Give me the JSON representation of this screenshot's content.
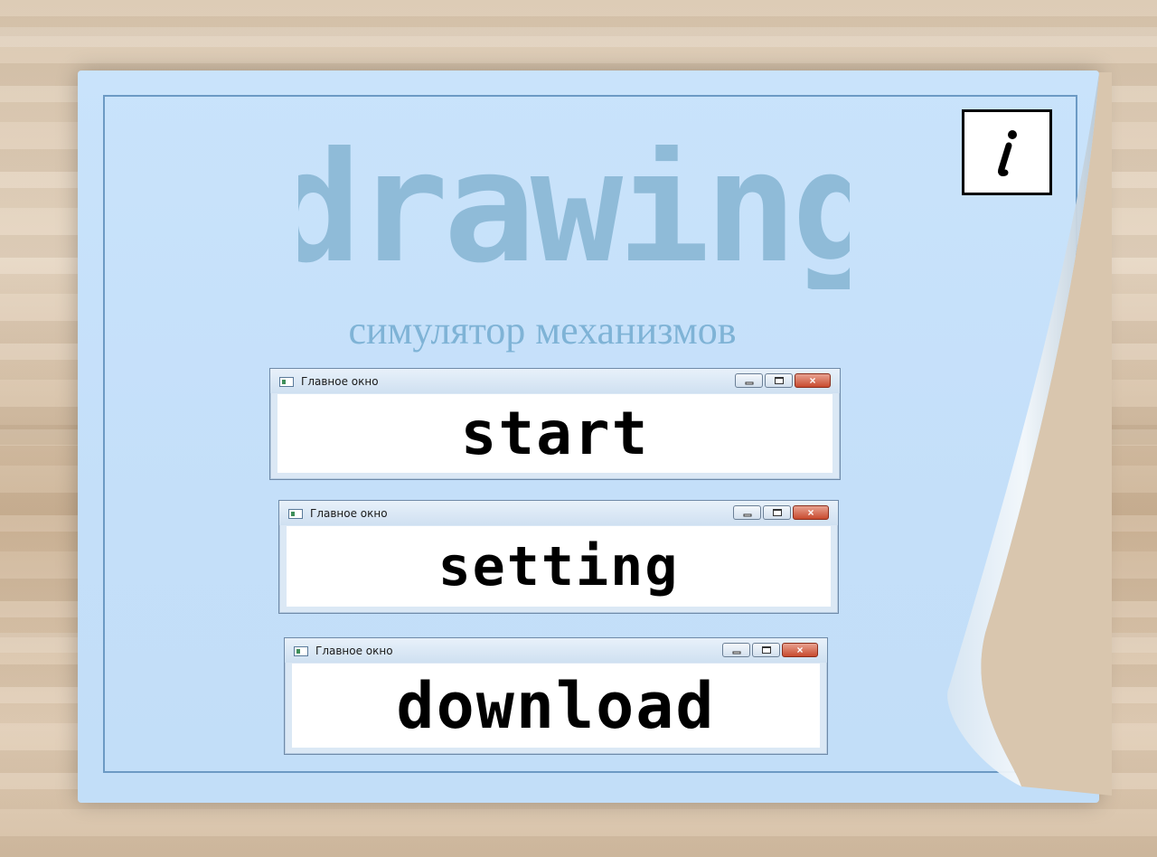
{
  "app": {
    "title": "drawing",
    "subtitle": "симулятор механизмов"
  },
  "info_button": {
    "label": "i"
  },
  "menu": {
    "items": [
      {
        "window_title": "Главное окно",
        "label": "start"
      },
      {
        "window_title": "Главное окно",
        "label": "setting"
      },
      {
        "window_title": "Главное окно",
        "label": "download"
      }
    ],
    "controls": {
      "close": "×"
    }
  },
  "colors": {
    "paper": "#c4dff9",
    "title": "#8fbbd8",
    "subtitle": "#7fb3d6",
    "wood": "#d9c6ae"
  }
}
